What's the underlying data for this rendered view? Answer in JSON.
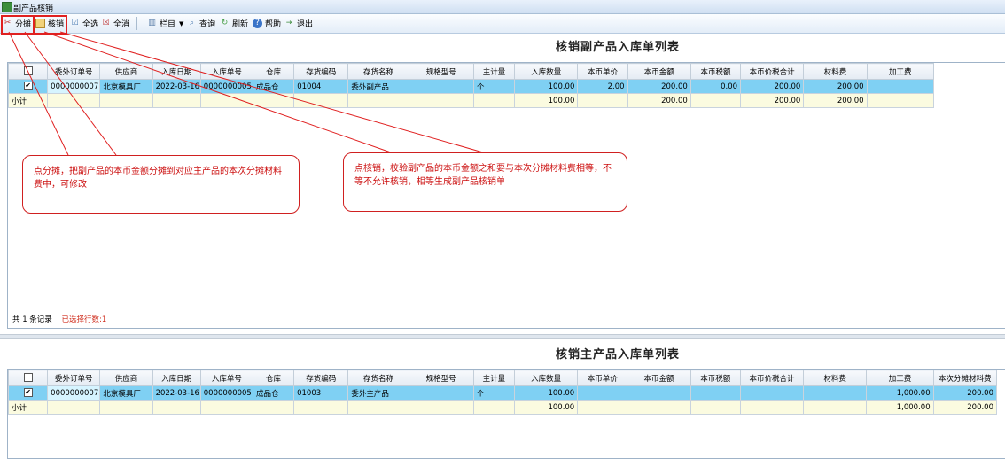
{
  "window": {
    "title": "副产品核销"
  },
  "toolbar": {
    "allocate": "分摊",
    "writeoff": "核销",
    "select_all": "全选",
    "deselect_all": "全消",
    "columns": "栏目",
    "query": "查询",
    "refresh": "刷新",
    "help": "帮助",
    "exit": "退出"
  },
  "by_product": {
    "title": "核销副产品入库单列表",
    "columns": [
      "委外订单号",
      "供应商",
      "入库日期",
      "入库单号",
      "仓库",
      "存货编码",
      "存货名称",
      "规格型号",
      "主计量",
      "入库数量",
      "本币单价",
      "本币金额",
      "本币税额",
      "本币价税合计",
      "材料费",
      "加工费"
    ],
    "rows": [
      {
        "checked": "✔",
        "cells": [
          "0000000007",
          "北京模具厂",
          "2022-03-16",
          "0000000005",
          "成品仓",
          "01004",
          "委外副产品",
          "",
          "个",
          "100.00",
          "2.00",
          "200.00",
          "0.00",
          "200.00",
          "200.00",
          ""
        ]
      }
    ],
    "subtotal": {
      "label": "小计",
      "cells": [
        "",
        "",
        "",
        "",
        "",
        "",
        "",
        "",
        "",
        "100.00",
        "",
        "200.00",
        "",
        "200.00",
        "200.00",
        ""
      ]
    },
    "footer_total": "共 1 条记录",
    "footer_selected": "已选择行数:1"
  },
  "main_product": {
    "title": "核销主产品入库单列表",
    "columns": [
      "委外订单号",
      "供应商",
      "入库日期",
      "入库单号",
      "仓库",
      "存货编码",
      "存货名称",
      "规格型号",
      "主计量",
      "入库数量",
      "本币单价",
      "本币金额",
      "本币税额",
      "本币价税合计",
      "材料费",
      "加工费",
      "本次分摊材料费"
    ],
    "rows": [
      {
        "checked": "✔",
        "cells": [
          "0000000007",
          "北京模具厂",
          "2022-03-16",
          "0000000005",
          "成品仓",
          "01003",
          "委外主产品",
          "",
          "个",
          "100.00",
          "",
          "",
          "",
          "",
          "",
          "1,000.00",
          "200.00"
        ]
      }
    ],
    "subtotal": {
      "label": "小计",
      "cells": [
        "",
        "",
        "",
        "",
        "",
        "",
        "",
        "",
        "",
        "100.00",
        "",
        "",
        "",
        "",
        "",
        "1,000.00",
        "200.00"
      ]
    }
  },
  "callouts": {
    "allocate_note": "点分摊，把副产品的本币金额分摊到对应主产品的本次分摊材料费中，可修改",
    "writeoff_note": "点核销，校验副产品的本币金额之和要与本次分摊材料费相等，不等不允许核销，相等生成副产品核销单"
  },
  "colors": {
    "selected_row": "#7fd0f3",
    "annotation": "#e02020"
  }
}
